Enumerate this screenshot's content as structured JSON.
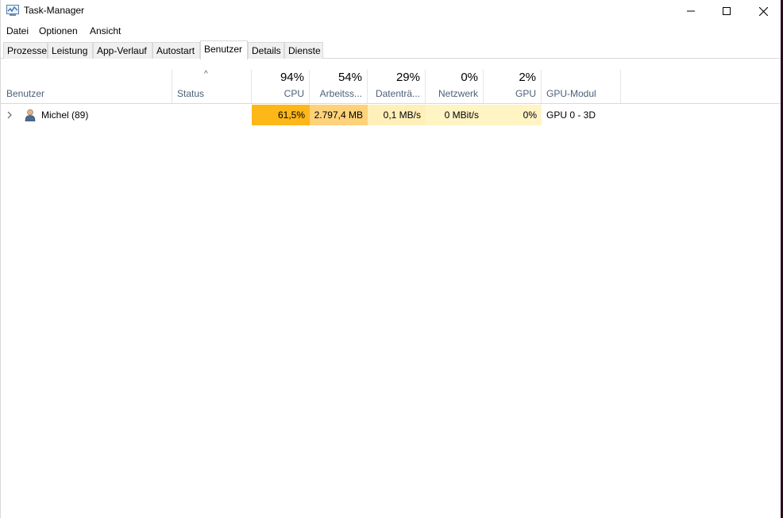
{
  "window": {
    "title": "Task-Manager",
    "icons": [
      "task-manager-icon",
      "minimize-icon",
      "maximize-icon",
      "close-icon"
    ]
  },
  "menu": [
    "Datei",
    "Optionen",
    "Ansicht"
  ],
  "tabs": [
    "Prozesse",
    "Leistung",
    "App-Verlauf",
    "Autostart",
    "Benutzer",
    "Details",
    "Dienste"
  ],
  "active_tab": "Benutzer",
  "columns": {
    "user": {
      "label": "Benutzer"
    },
    "status": {
      "label": "Status"
    },
    "cpu": {
      "label": "CPU",
      "percent": "94%"
    },
    "memory": {
      "label": "Arbeitss...",
      "percent": "54%"
    },
    "disk": {
      "label": "Datenträ...",
      "percent": "29%"
    },
    "network": {
      "label": "Netzwerk",
      "percent": "0%"
    },
    "gpu": {
      "label": "GPU",
      "percent": "2%"
    },
    "gpu_engine": {
      "label": "GPU-Modul"
    }
  },
  "rows": [
    {
      "name": "Michel (89)",
      "status": "",
      "cpu": "61,5%",
      "memory": "2.797,4 MB",
      "disk": "0,1 MB/s",
      "network": "0 MBit/s",
      "gpu": "0%",
      "gpu_engine": "GPU 0 - 3D"
    }
  ],
  "colors": {
    "cpu_cell": "#fdb719",
    "memory_cell": "#fdd27a",
    "disk_cell": "#fff0b9",
    "network_cell": "#fff4c4",
    "gpu_cell": "#fff4c4",
    "header_label": "#4c607a"
  }
}
